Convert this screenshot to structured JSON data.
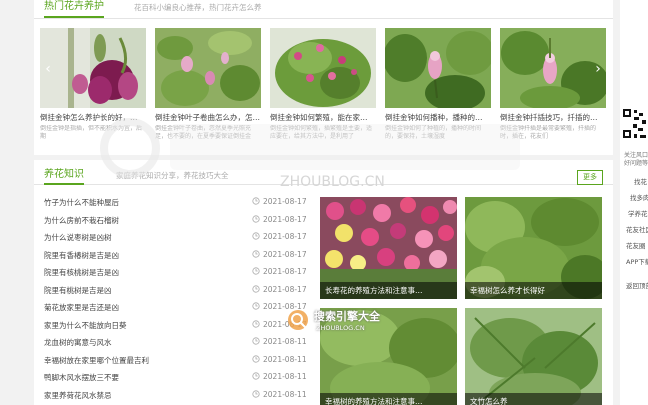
{
  "top_section": {
    "title": "热门花卉养护",
    "subtitle": "花百科小编良心推荐，热门花卉怎么养",
    "cards": [
      {
        "title": "倒挂金钟怎么养护长的好，…",
        "desc": "倒挂金钟是指插，但不能积水为宜，后期"
      },
      {
        "title": "倒挂金钟叶子卷曲怎么办，怎…",
        "desc": "倒挂金钟叶子卷曲，忽然夏季光照充足，也不要的，在夏季要保证倒挂金"
      },
      {
        "title": "倒挂金钟如何繁殖，能在家…",
        "desc": "倒挂金钟如何繁殖，插繁殖是主要，适应要在，给其方法中，是利用了"
      },
      {
        "title": "倒挂金钟如何播种，播种的…",
        "desc": "倒挂金钟如何了种植的，播种的时间的，要保持，土壤湿度"
      },
      {
        "title": "倒挂金钟扦插技巧，扦插的…",
        "desc": "倒挂金钟扦插是最常要繁殖，扦插的时，插在，花友们"
      }
    ],
    "prev_label": "‹",
    "next_label": "›"
  },
  "knowledge_section": {
    "title": "养花知识",
    "subtitle": "家庭养花知识分享，养花技巧大全",
    "more_label": "更多",
    "articles": [
      {
        "title": "竹子为什么不能种屋后",
        "date": "2021-08-17"
      },
      {
        "title": "为什么房前不栽石榴树",
        "date": "2021-08-17"
      },
      {
        "title": "为什么说枣树是凶树",
        "date": "2021-08-17"
      },
      {
        "title": "院里有香椿树是吉是凶",
        "date": "2021-08-17"
      },
      {
        "title": "院里有核桃树是吉是凶",
        "date": "2021-08-17"
      },
      {
        "title": "院里有桃树是吉是凶",
        "date": "2021-08-17"
      },
      {
        "title": "菊花放家里是吉还是凶",
        "date": "2021-08-17"
      },
      {
        "title": "家里为什么不能放向日葵",
        "date": "2021-08-17"
      },
      {
        "title": "龙血树的寓意与风水",
        "date": "2021-08-11"
      },
      {
        "title": "幸福树放在家里哪个位置最吉利",
        "date": "2021-08-11"
      },
      {
        "title": "鸭脚木风水摆放三不要",
        "date": "2021-08-11"
      },
      {
        "title": "家里养荷花风水禁忌",
        "date": "2021-08-11"
      }
    ],
    "tiles": [
      {
        "caption": "长寿花的养殖方法和注意事…"
      },
      {
        "caption": "幸福树怎么养才长得好"
      },
      {
        "caption": "幸福树的养殖方法和注意事…"
      },
      {
        "caption": "文竹怎么养"
      }
    ]
  },
  "sidebar": {
    "qr_caption_1": "关注风口",
    "qr_caption_2": "好问题等你",
    "links": [
      "找花",
      "找多肉",
      "学养花",
      "花友社区",
      "花友圈",
      "APP下载"
    ],
    "back_to_top": "返回顶部"
  },
  "watermarks": {
    "top_text": "ZHOUBLOG.CN",
    "mid_text": "搜索引擎大全",
    "mid_sub": "ZHOUBLOG.CN"
  },
  "colors": {
    "accent": "#5aa51e",
    "caption_bg": "#000000"
  }
}
